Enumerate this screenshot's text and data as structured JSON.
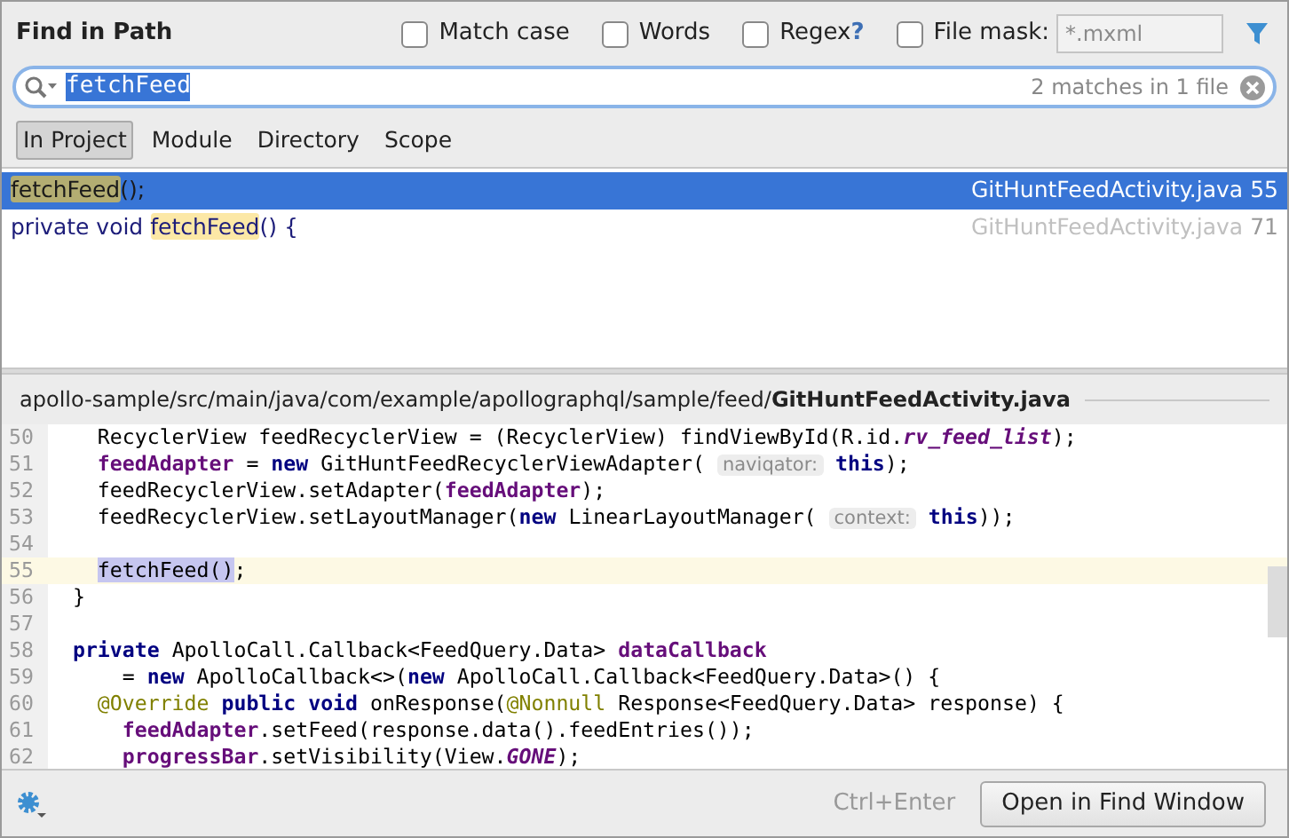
{
  "dialog": {
    "title": "Find in Path"
  },
  "options": [
    {
      "label": "Match case",
      "checked": false
    },
    {
      "label": "Words",
      "checked": false
    },
    {
      "label": "Regex",
      "checked": false,
      "help": "?"
    },
    {
      "label": "File mask:",
      "checked": false,
      "placeholder": "*.mxml"
    }
  ],
  "search": {
    "value": "fetchFeed",
    "match_count": "2 matches in 1 file"
  },
  "scopes": [
    {
      "label": "In Project",
      "selected": true
    },
    {
      "label": "Module",
      "selected": false
    },
    {
      "label": "Directory",
      "selected": false
    },
    {
      "label": "Scope",
      "selected": false
    }
  ],
  "results": [
    {
      "match": "fetchFeed",
      "after": "();",
      "file": "GitHuntFeedActivity.java",
      "line": "55",
      "selected": true
    },
    {
      "before": "private void ",
      "match": "fetchFeed",
      "after": "() {",
      "file": "GitHuntFeedActivity.java",
      "line": "71",
      "selected": false
    }
  ],
  "preview": {
    "path": "apollo-sample/src/main/java/com/example/apollographql/sample/feed/",
    "file": "GitHuntFeedActivity.java",
    "lines": [
      {
        "number": "50",
        "current": false,
        "tokens": [
          {
            "kind": "plain",
            "text": "    RecyclerView feedRecyclerView = (RecyclerView) findViewById(R.id."
          },
          {
            "kind": "static",
            "text": "rv_feed_list"
          },
          {
            "kind": "plain",
            "text": ");"
          }
        ]
      },
      {
        "number": "51",
        "current": false,
        "tokens": [
          {
            "kind": "field",
            "text": "    feedAdapter"
          },
          {
            "kind": "plain",
            "text": " = "
          },
          {
            "kind": "keyword",
            "text": "new"
          },
          {
            "kind": "plain",
            "text": " GitHuntFeedRecyclerViewAdapter( "
          },
          {
            "kind": "hint",
            "text": "naviqator:"
          },
          {
            "kind": "keyword",
            "text": " this"
          },
          {
            "kind": "plain",
            "text": ");"
          }
        ]
      },
      {
        "number": "52",
        "current": false,
        "tokens": [
          {
            "kind": "plain",
            "text": "    feedRecyclerView.setAdapter("
          },
          {
            "kind": "field",
            "text": "feedAdapter"
          },
          {
            "kind": "plain",
            "text": ");"
          }
        ]
      },
      {
        "number": "53",
        "current": false,
        "tokens": [
          {
            "kind": "plain",
            "text": "    feedRecyclerView.setLayoutManager("
          },
          {
            "kind": "keyword",
            "text": "new"
          },
          {
            "kind": "plain",
            "text": " LinearLayoutManager( "
          },
          {
            "kind": "hint",
            "text": "context:"
          },
          {
            "kind": "keyword",
            "text": " this"
          },
          {
            "kind": "plain",
            "text": "));"
          }
        ]
      },
      {
        "number": "54",
        "current": false
      },
      {
        "number": "55",
        "current": true,
        "tokens": [
          {
            "kind": "selected",
            "text": "    fetchFeed()"
          },
          {
            "kind": "plain",
            "text": ";"
          }
        ]
      },
      {
        "number": "56",
        "current": false,
        "tokens": [
          {
            "kind": "plain",
            "text": "  }"
          }
        ]
      },
      {
        "number": "57",
        "current": false
      },
      {
        "number": "58",
        "current": false,
        "tokens": [
          {
            "kind": "keyword",
            "text": "  private"
          },
          {
            "kind": "plain",
            "text": " ApolloCall.Callback<FeedQuery.Data> "
          },
          {
            "kind": "field",
            "text": "dataCallback"
          }
        ]
      },
      {
        "number": "59",
        "current": false,
        "tokens": [
          {
            "kind": "plain",
            "text": "      = "
          },
          {
            "kind": "keyword",
            "text": "new"
          },
          {
            "kind": "plain",
            "text": " ApolloCallback<>("
          },
          {
            "kind": "keyword",
            "text": "new"
          },
          {
            "kind": "plain",
            "text": " ApolloCall.Callback<FeedQuery.Data>() {"
          }
        ]
      },
      {
        "number": "60",
        "current": false,
        "tokens": [
          {
            "kind": "annotation",
            "text": "    @Override"
          },
          {
            "kind": "keyword",
            "text": " public void"
          },
          {
            "kind": "plain",
            "text": " onResponse("
          },
          {
            "kind": "annotation",
            "text": "@Nonnull"
          },
          {
            "kind": "plain",
            "text": " Response<FeedQuery.Data> response) {"
          }
        ]
      },
      {
        "number": "61",
        "current": false,
        "tokens": [
          {
            "kind": "field",
            "text": "      feedAdapter"
          },
          {
            "kind": "plain",
            "text": ".setFeed(response.data().feedEntries());"
          }
        ]
      },
      {
        "number": "62",
        "current": false,
        "tokens": [
          {
            "kind": "field",
            "text": "      progressBar"
          },
          {
            "kind": "plain",
            "text": ".setVisibility(View."
          },
          {
            "kind": "static",
            "text": "GONE"
          },
          {
            "kind": "plain",
            "text": ");"
          }
        ]
      }
    ]
  },
  "footer": {
    "shortcut": "Ctrl+Enter",
    "button": "Open in Find Window"
  }
}
